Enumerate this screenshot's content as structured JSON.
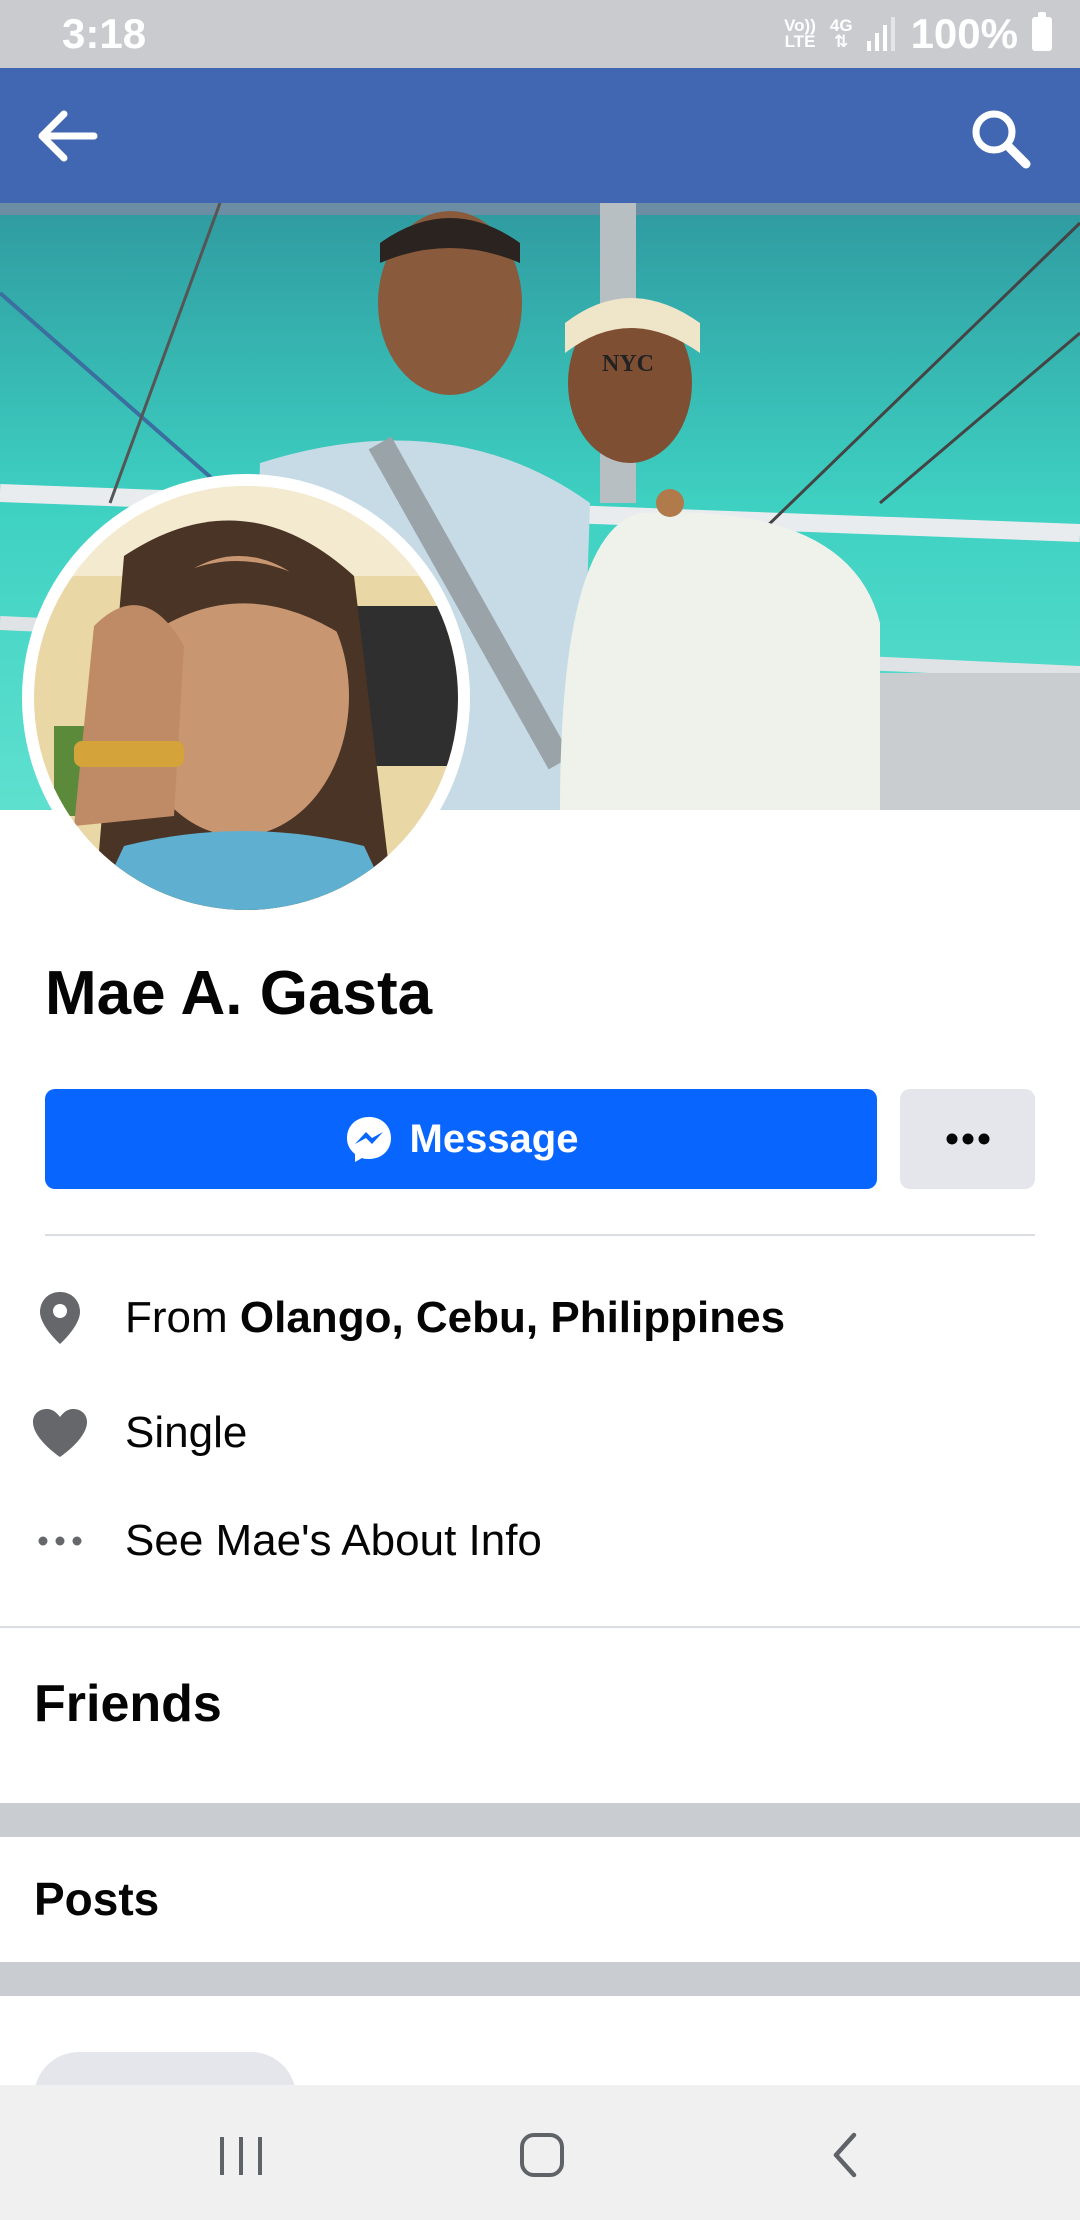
{
  "status_bar": {
    "time": "3:18",
    "volte_label_top": "Vo))",
    "volte_label_bottom": "LTE",
    "network_label": "4G",
    "battery_percent": "100%"
  },
  "app_bar": {
    "back_icon": "arrow-left-icon",
    "search_icon": "search-icon",
    "background_color": "#4267b2"
  },
  "cover": {
    "cap_text": "NYC"
  },
  "profile": {
    "name": "Mae A. Gasta"
  },
  "actions": {
    "message_label": "Message",
    "message_color": "#0866ff"
  },
  "info": {
    "from_prefix": "From ",
    "from_location": "Olango, Cebu, Philippines",
    "relationship": "Single",
    "about_link": "See Mae's About Info"
  },
  "sections": {
    "friends_title": "Friends",
    "posts_title": "Posts"
  }
}
